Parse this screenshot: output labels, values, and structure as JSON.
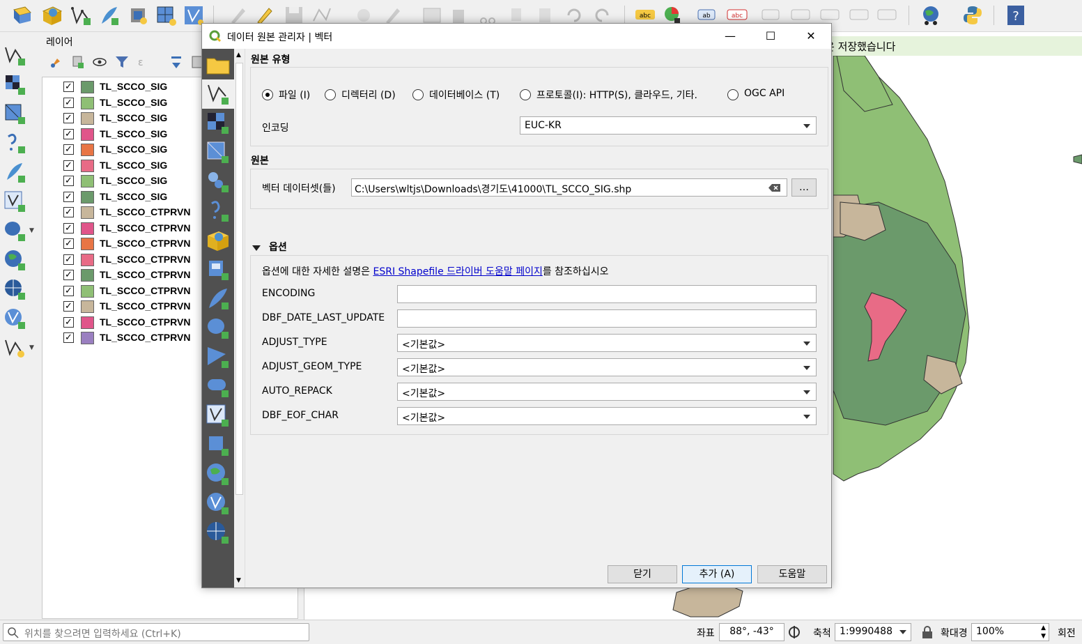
{
  "toolbar": {
    "icons": [
      "open-project",
      "new-project",
      "digitize",
      "pen",
      "copy",
      "grid",
      "vector",
      "edit-disabled",
      "pencil",
      "save",
      "node",
      "dots",
      "pen-tool",
      "table",
      "delete",
      "cut",
      "copy-doc",
      "paste",
      "undo",
      "redo",
      "label-abc",
      "chart",
      "label-ab",
      "label-red",
      "label-1",
      "label-2",
      "label-3",
      "label-4",
      "label-5",
      "python-console",
      "python",
      "help"
    ]
  },
  "layers_panel": {
    "title": "레이어",
    "layers": [
      {
        "name": "TL_SCCO_SIG",
        "color": "#6b9a6b",
        "checked": "✓"
      },
      {
        "name": "TL_SCCO_SIG",
        "color": "#8fbf75",
        "checked": "✓"
      },
      {
        "name": "TL_SCCO_SIG",
        "color": "#c7b69b",
        "checked": "✓"
      },
      {
        "name": "TL_SCCO_SIG",
        "color": "#e0558a",
        "checked": "✓"
      },
      {
        "name": "TL_SCCO_SIG",
        "color": "#e87545",
        "checked": "✓"
      },
      {
        "name": "TL_SCCO_SIG",
        "color": "#e86b86",
        "checked": "✓"
      },
      {
        "name": "TL_SCCO_SIG",
        "color": "#8fbf75",
        "checked": "✓"
      },
      {
        "name": "TL_SCCO_SIG",
        "color": "#6b9a6b",
        "checked": "✓"
      },
      {
        "name": "TL_SCCO_CTPRVN",
        "color": "#c7b69b",
        "checked": "✓"
      },
      {
        "name": "TL_SCCO_CTPRVN",
        "color": "#e0558a",
        "checked": "✓"
      },
      {
        "name": "TL_SCCO_CTPRVN",
        "color": "#e87545",
        "checked": "✓"
      },
      {
        "name": "TL_SCCO_CTPRVN",
        "color": "#e86b86",
        "checked": "✓"
      },
      {
        "name": "TL_SCCO_CTPRVN",
        "color": "#6b9a6b",
        "checked": "✓"
      },
      {
        "name": "TL_SCCO_CTPRVN",
        "color": "#8fbf75",
        "checked": "✓"
      },
      {
        "name": "TL_SCCO_CTPRVN",
        "color": "#c7b69b",
        "checked": "✓"
      },
      {
        "name": "TL_SCCO_CTPRVN",
        "color": "#e0558a",
        "checked": "✓"
      },
      {
        "name": "TL_SCCO_CTPRVN",
        "color": "#9a7fc0",
        "checked": "✓"
      }
    ]
  },
  "map": {
    "message": "은 저장했습니다"
  },
  "status": {
    "locator_placeholder": "위치를 찾으려면 입력하세요 (Ctrl+K)",
    "coord_label": "좌표",
    "coord_value": "88°, -43°",
    "scale_label": "축척",
    "scale_value": "1:9990488",
    "magnifier_label": "확대경",
    "magnifier_value": "100%",
    "rotation_label": "회전"
  },
  "dialog": {
    "title": "데이터 원본 관리자 | 벡터",
    "source_type_title": "원본 유형",
    "radios": [
      {
        "label": "파일 (I)",
        "selected": true
      },
      {
        "label": "디렉터리 (D)",
        "selected": false
      },
      {
        "label": "데이터베이스 (T)",
        "selected": false
      },
      {
        "label": "프로토콜(I): HTTP(S), 클라우드, 기타.",
        "selected": false
      },
      {
        "label": "OGC API",
        "selected": false
      }
    ],
    "encoding_label": "인코딩",
    "encoding_value": "EUC-KR",
    "source_title": "원본",
    "dataset_label": "벡터 데이터셋(들)",
    "dataset_value": "C:\\Users\\wltjs\\Downloads\\경기도\\41000\\TL_SCCO_SIG.shp",
    "browse_label": "…",
    "options_title": "옵션",
    "options_help_prefix": "옵션에 대한 자세한 설명은 ",
    "options_help_link": "ESRI Shapefile 드라이버 도움말 페이지",
    "options_help_suffix": "를 참조하십시오",
    "options": [
      {
        "label": "ENCODING",
        "kind": "text",
        "value": ""
      },
      {
        "label": "DBF_DATE_LAST_UPDATE",
        "kind": "text",
        "value": ""
      },
      {
        "label": "ADJUST_TYPE",
        "kind": "combo",
        "value": "<기본값>"
      },
      {
        "label": "ADJUST_GEOM_TYPE",
        "kind": "combo",
        "value": "<기본값>"
      },
      {
        "label": "AUTO_REPACK",
        "kind": "combo",
        "value": "<기본값>"
      },
      {
        "label": "DBF_EOF_CHAR",
        "kind": "combo",
        "value": "<기본값>"
      }
    ],
    "close_btn": "닫기",
    "add_btn": "추가 (A)",
    "help_btn": "도움말"
  }
}
